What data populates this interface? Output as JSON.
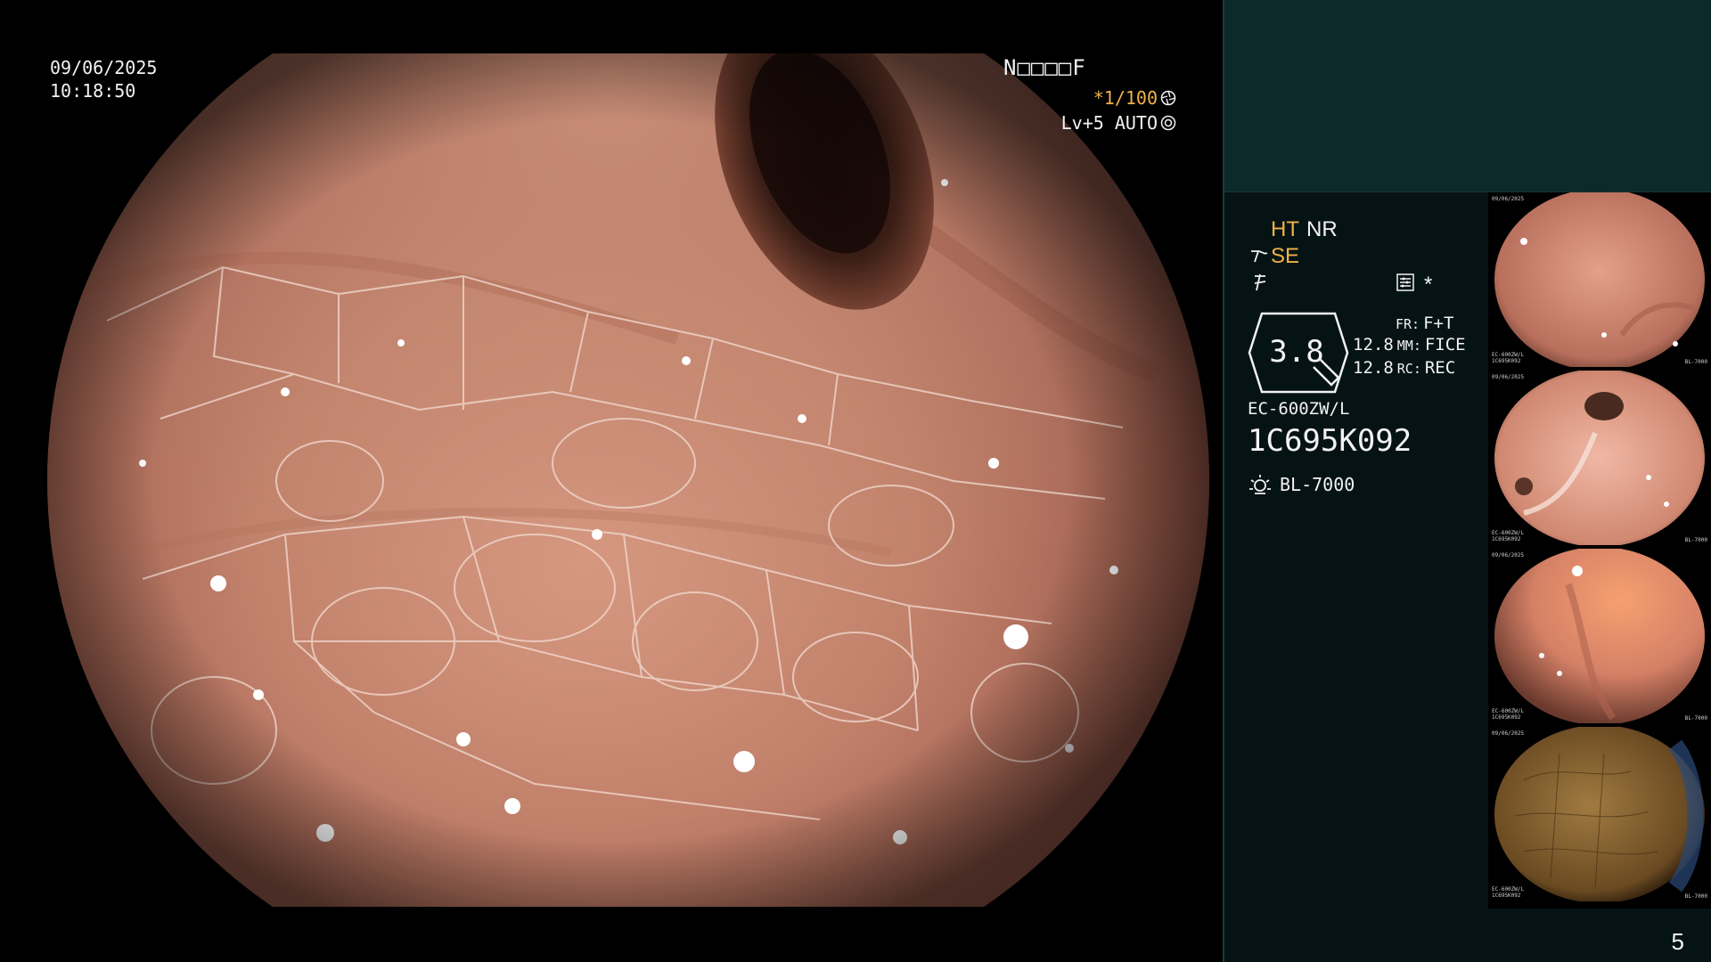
{
  "scope_view": {
    "date": "09/06/2025",
    "time": "10:18:50",
    "patient_id": "N□□□□F",
    "shutter": "*1/100",
    "level": "Lv+5 AUTO"
  },
  "side_panel": {
    "ht_label": "HT",
    "nr_label": "NR",
    "se_label": "SE",
    "star_label": "*",
    "zoom": "3.8",
    "fr_key": "FR:",
    "fr_value": "F+T",
    "mm_key": "MM:",
    "mm_pre": "12.8",
    "mm_value": "FICE",
    "rc_key": "RC:",
    "rc_pre": "12.8",
    "rc_value": "REC",
    "scope_model": "EC-600ZW/L",
    "scope_serial": "1C695K092",
    "light_source": "BL-7000",
    "page_number": "5"
  },
  "thumbnails": [
    {
      "name": "thumb-1",
      "label_date": "09/06/2025",
      "label_serial": "1C695K092",
      "label_model": "EC-600ZW/L",
      "label_light": "BL-7000",
      "index": "1"
    },
    {
      "name": "thumb-2",
      "label_date": "09/06/2025",
      "label_serial": "1C695K092",
      "label_model": "EC-600ZW/L",
      "label_light": "BL-7000",
      "index": "2"
    },
    {
      "name": "thumb-3",
      "label_date": "09/06/2025",
      "label_serial": "1C695K092",
      "label_model": "EC-600ZW/L",
      "label_light": "BL-7000",
      "index": "3"
    },
    {
      "name": "thumb-4",
      "label_date": "09/06/2025",
      "label_serial": "1C695K092",
      "label_model": "EC-600ZW/L",
      "label_light": "BL-7000",
      "index": "4"
    }
  ],
  "colors": {
    "accent_orange": "#f0b24a",
    "panel_teal": "#0d2a2b",
    "panel_dark": "#061314",
    "mucosa": "#b06f5c"
  }
}
